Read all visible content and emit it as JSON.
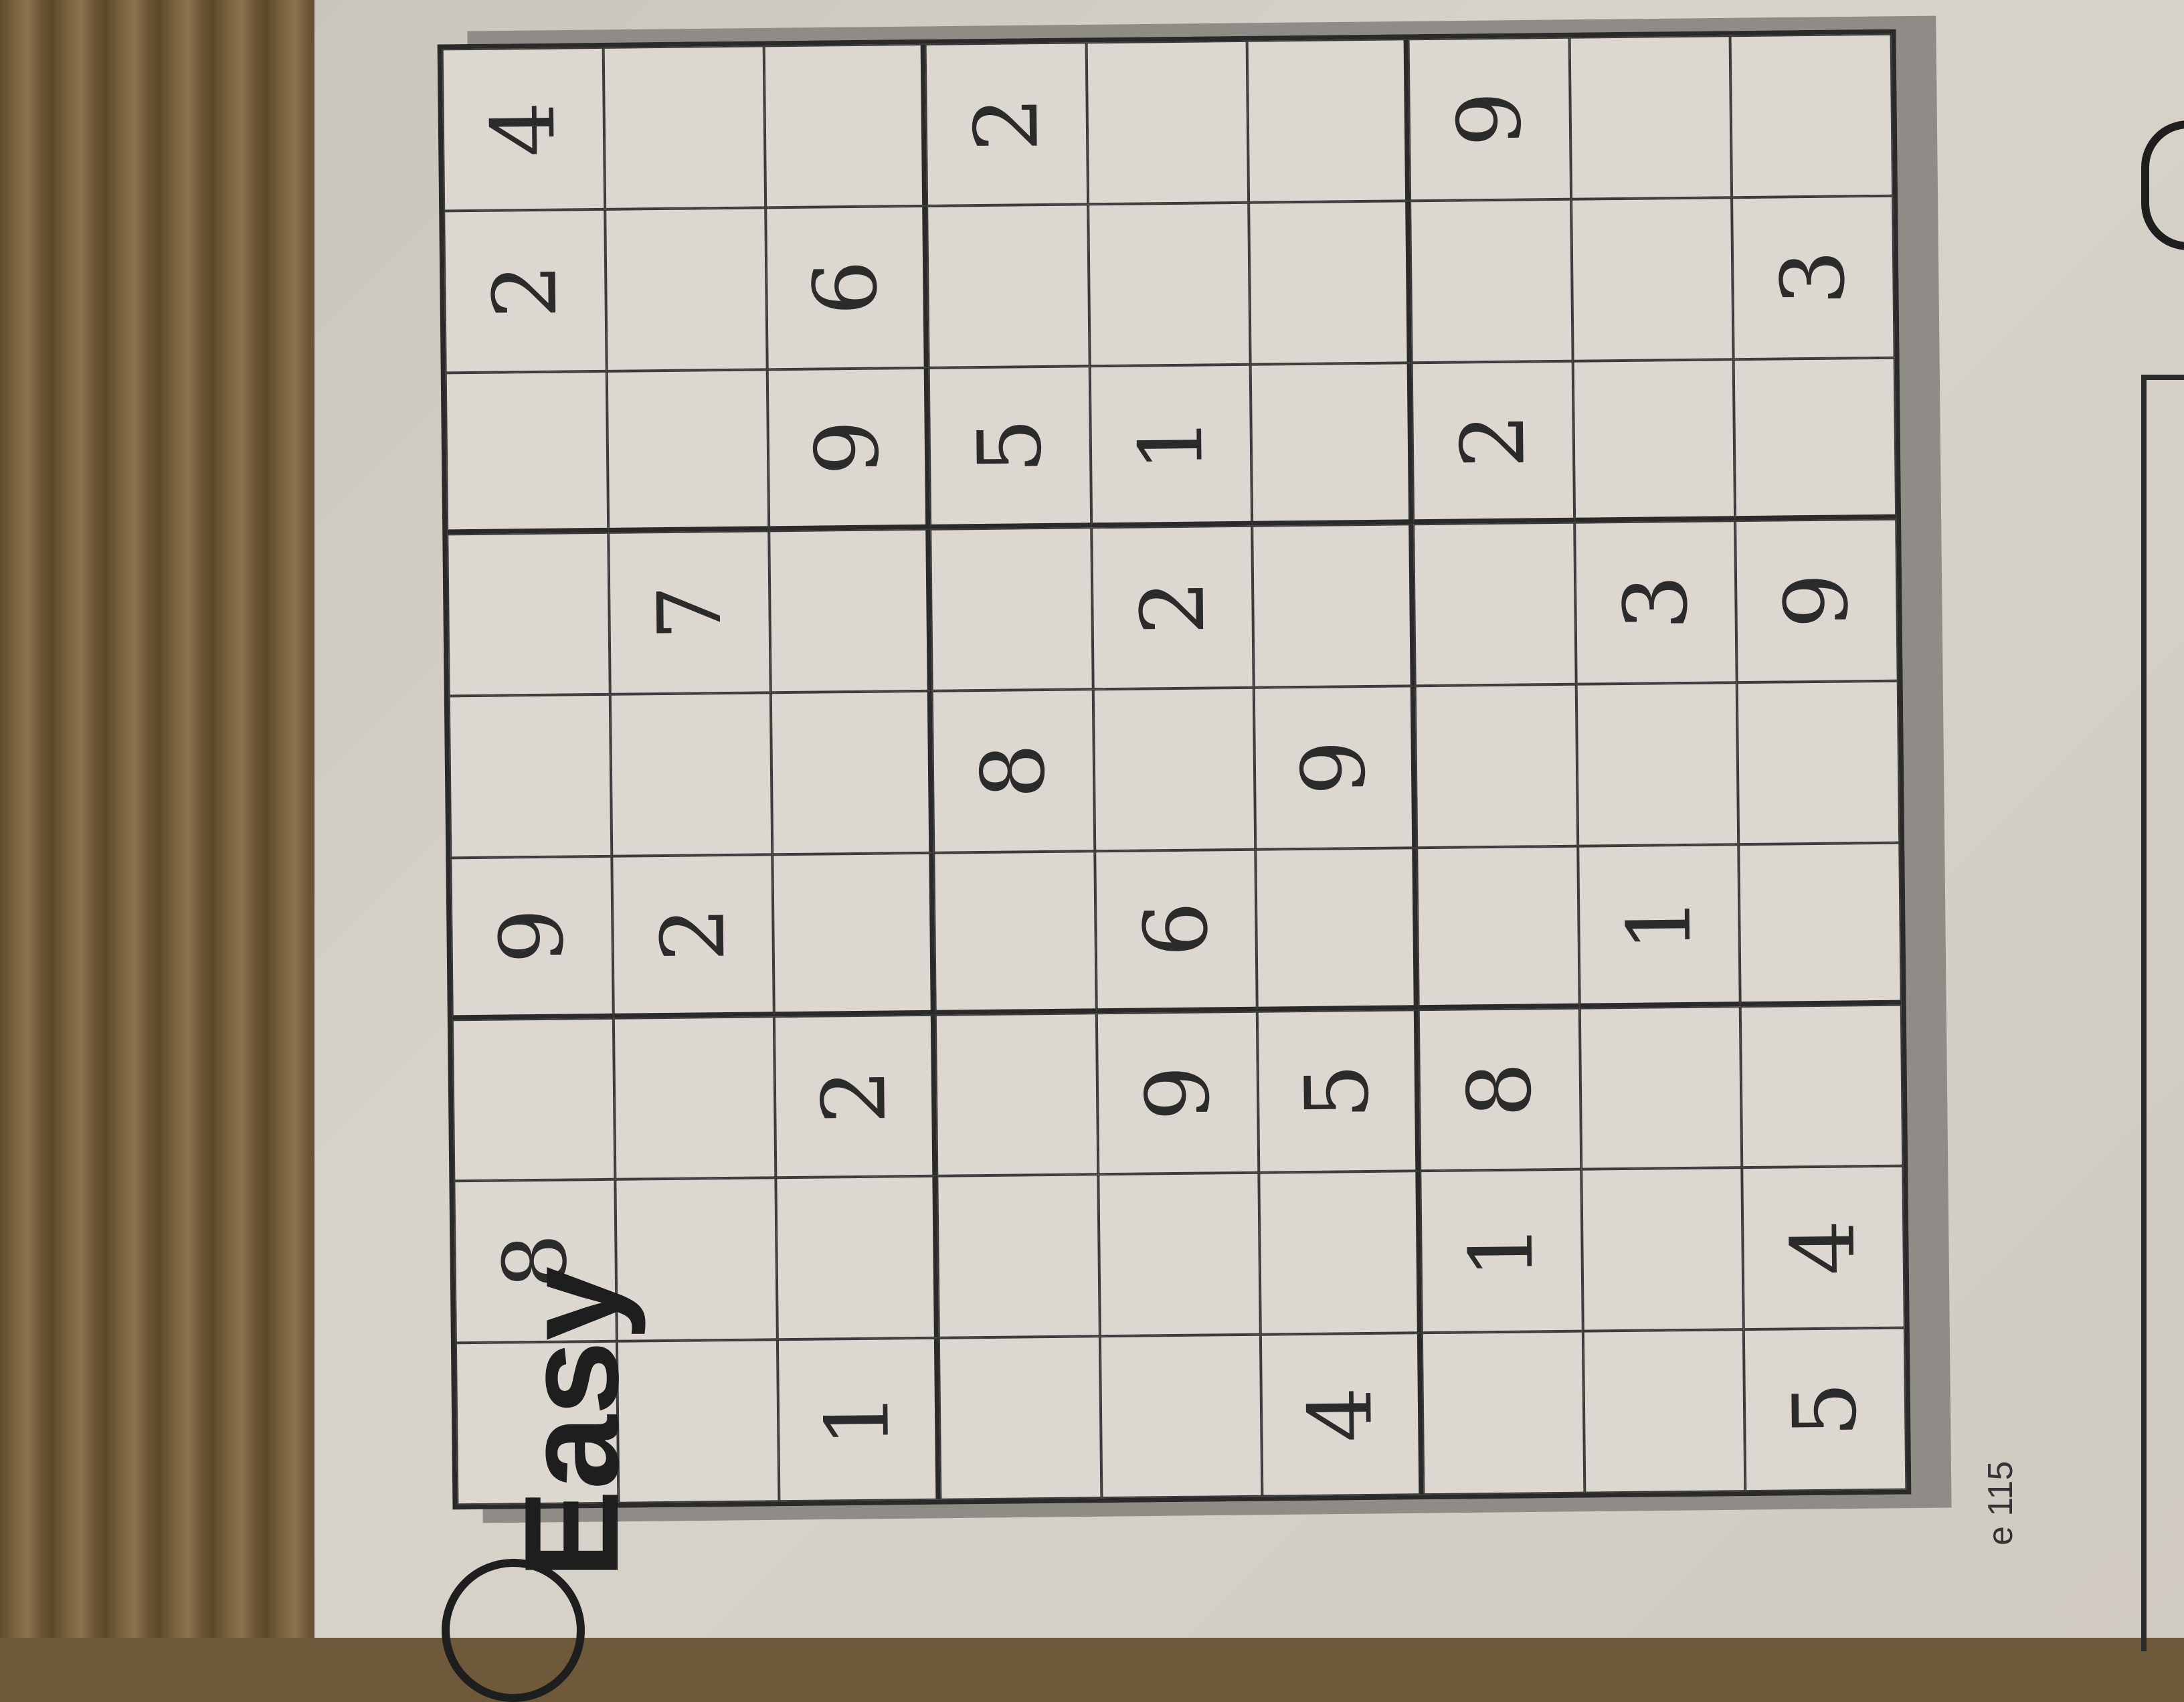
{
  "page_label": "e 115",
  "title": "Easy",
  "grid": {
    "rows": [
      [
        "",
        "8",
        "",
        "9",
        "",
        "",
        "",
        "2",
        "4"
      ],
      [
        "",
        "",
        "",
        "2",
        "",
        "7",
        "",
        "",
        ""
      ],
      [
        "1",
        "",
        "2",
        "",
        "",
        "",
        "9",
        "6",
        ""
      ],
      [
        "",
        "",
        "",
        "",
        "8",
        "",
        "5",
        "",
        "2"
      ],
      [
        "",
        "",
        "9",
        "6",
        "",
        "2",
        "1",
        "",
        ""
      ],
      [
        "4",
        "",
        "5",
        "",
        "9",
        "",
        "",
        "",
        ""
      ],
      [
        "",
        "1",
        "8",
        "",
        "",
        "",
        "2",
        "",
        "9"
      ],
      [
        "",
        "",
        "",
        "1",
        "",
        "3",
        "",
        "",
        ""
      ],
      [
        "5",
        "4",
        "",
        "",
        "",
        "9",
        "",
        "3",
        ""
      ]
    ]
  }
}
